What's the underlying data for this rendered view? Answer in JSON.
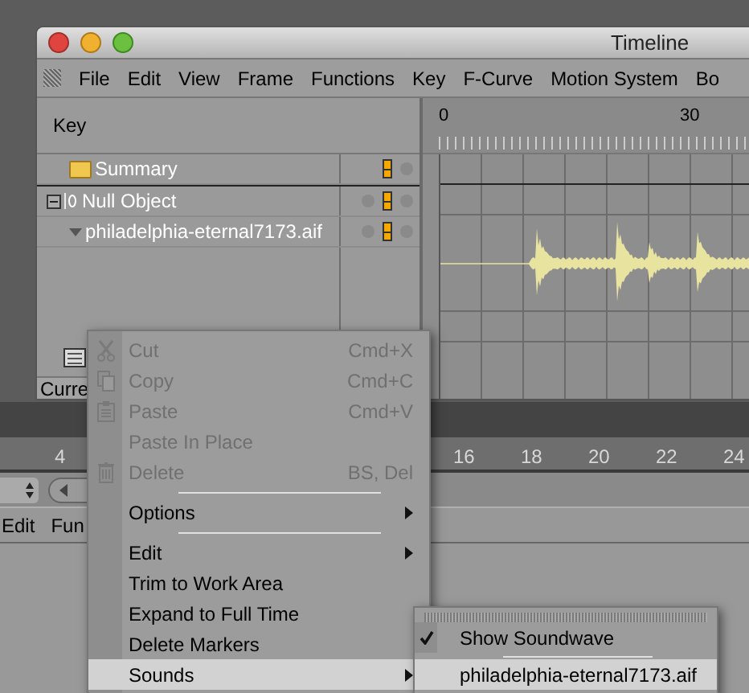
{
  "window": {
    "title": "Timeline"
  },
  "menu_bar": [
    "File",
    "Edit",
    "View",
    "Frame",
    "Functions",
    "Key",
    "F-Curve",
    "Motion System",
    "Bo"
  ],
  "key_panel": {
    "header": "Key",
    "rows": [
      {
        "kind": "folder",
        "label": "Summary"
      },
      {
        "kind": "null",
        "label": "Null Object",
        "expanded": true,
        "children": [
          {
            "kind": "sound",
            "label": "philadelphia-eternal7173.aif"
          }
        ]
      }
    ]
  },
  "ruler": [
    "0",
    "30"
  ],
  "status_bar": "Curre",
  "back_ruler": [
    "4",
    "16",
    "18",
    "20",
    "22",
    "24"
  ],
  "back_menu_bar": [
    "Edit",
    "Fun"
  ],
  "context_menu": [
    {
      "kind": "item",
      "label": "Cut",
      "shortcut": "Cmd+X",
      "disabled": true,
      "submenu": false,
      "selected": false
    },
    {
      "kind": "item",
      "label": "Copy",
      "shortcut": "Cmd+C",
      "disabled": true,
      "submenu": false,
      "selected": false
    },
    {
      "kind": "item",
      "label": "Paste",
      "shortcut": "Cmd+V",
      "disabled": true,
      "submenu": false,
      "selected": false
    },
    {
      "kind": "item",
      "label": "Paste In Place",
      "disabled": true,
      "submenu": false,
      "selected": false
    },
    {
      "kind": "item",
      "label": "Delete",
      "shortcut": "BS, Del",
      "disabled": true,
      "submenu": false,
      "selected": false
    },
    {
      "kind": "separator"
    },
    {
      "kind": "item",
      "label": "Options",
      "disabled": false,
      "submenu": true,
      "selected": false
    },
    {
      "kind": "separator"
    },
    {
      "kind": "item",
      "label": "Edit",
      "disabled": false,
      "submenu": true,
      "selected": false
    },
    {
      "kind": "item",
      "label": "Trim to Work Area",
      "disabled": false,
      "submenu": false,
      "selected": false
    },
    {
      "kind": "item",
      "label": "Expand to Full Time",
      "disabled": false,
      "submenu": false,
      "selected": false
    },
    {
      "kind": "item",
      "label": "Delete Markers",
      "disabled": false,
      "submenu": false,
      "selected": false
    },
    {
      "kind": "item",
      "label": "Sounds",
      "disabled": false,
      "submenu": true,
      "selected": true
    }
  ],
  "sounds_submenu": [
    {
      "kind": "check",
      "label": "Show Soundwave",
      "checked": true,
      "selected": false
    },
    {
      "kind": "separator"
    },
    {
      "kind": "item",
      "label": "philadelphia-eternal7173.aif",
      "checked": false,
      "selected": true
    }
  ]
}
